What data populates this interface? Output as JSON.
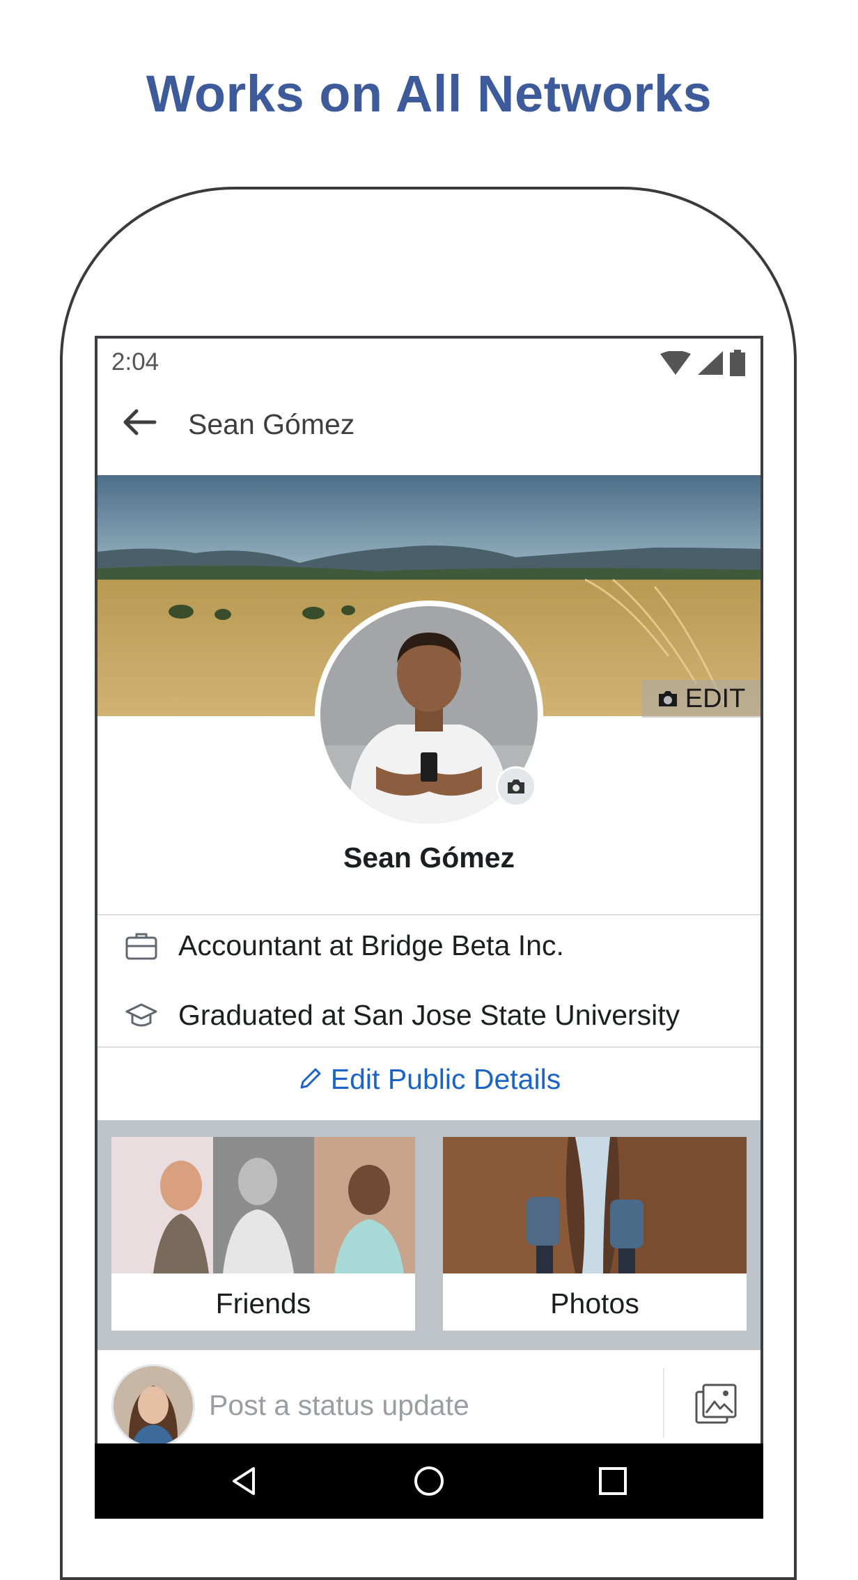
{
  "headline": "Works on All Networks",
  "status_bar": {
    "time": "2:04",
    "icons": [
      "wifi-icon",
      "signal-icon",
      "battery-icon"
    ]
  },
  "appbar": {
    "back_icon": "arrow-left-icon",
    "title": "Sean Gómez"
  },
  "cover": {
    "edit_label": "EDIT",
    "edit_icon": "camera-icon"
  },
  "profile": {
    "name": "Sean Gómez",
    "details": [
      {
        "icon": "briefcase-icon",
        "text": "Accountant at Bridge Beta Inc."
      },
      {
        "icon": "graduation-cap-icon",
        "text": "Graduated at San Jose State University"
      }
    ],
    "edit_details_label": "Edit Public Details",
    "edit_details_icon": "pencil-icon"
  },
  "cards": [
    {
      "label": "Friends"
    },
    {
      "label": "Photos"
    }
  ],
  "composer": {
    "placeholder": "Post a status update",
    "photo_icon": "image-icon"
  },
  "navbar": {
    "icons": [
      "back-triangle-icon",
      "home-circle-icon",
      "recents-square-icon"
    ]
  },
  "colors": {
    "headline": "#3d5a9a",
    "link": "#1b63c6",
    "grid_background": "#bec3c9",
    "divider": "#dadde1"
  }
}
